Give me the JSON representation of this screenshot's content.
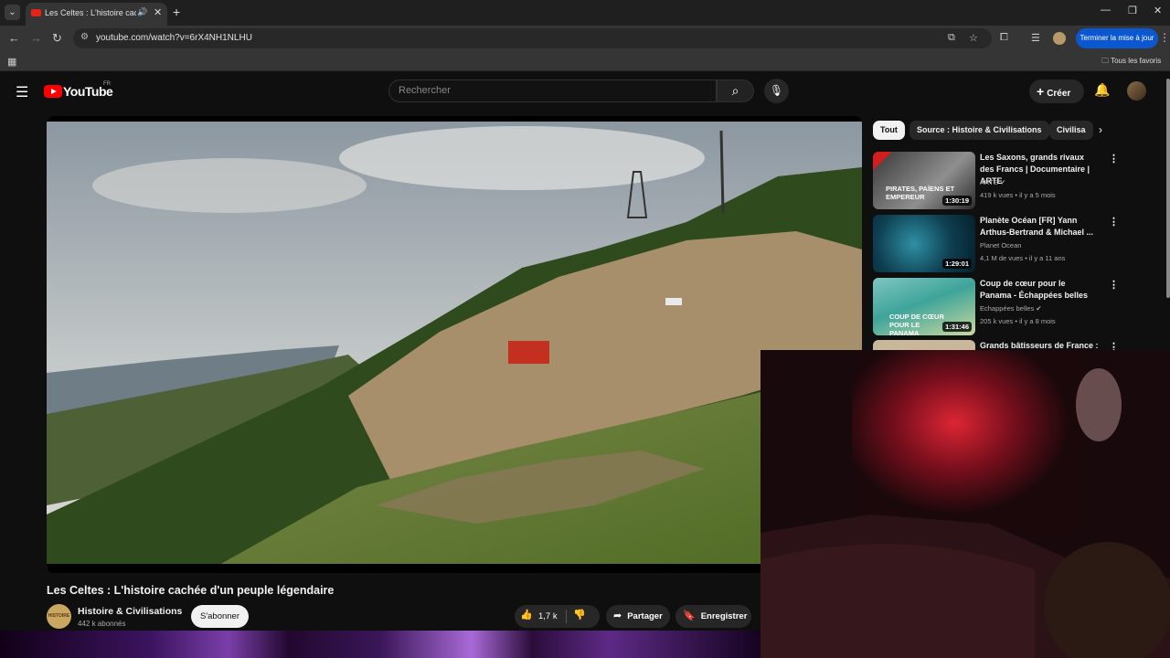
{
  "browser": {
    "tab_title": "Les Celtes : L'histoire cachée d'un peuple légendaire - YouTube",
    "url": "youtube.com/watch?v=6rX4NH1NLHU",
    "update_button": "Terminer la mise à jour",
    "all_bookmarks": "Tous les favoris"
  },
  "header": {
    "logo_text": "YouTube",
    "region": "FR",
    "search_placeholder": "Rechercher",
    "create_label": "Créer"
  },
  "video": {
    "title": "Les Celtes : L'histoire cachée d'un peuple légendaire",
    "channel": "Histoire & Civilisations",
    "avatar_text": "HISTOIRE",
    "subscribers": "442 k abonnés",
    "subscribe_label": "S'abonner",
    "likes": "1,7 k",
    "share_label": "Partager",
    "save_label": "Enregistrer"
  },
  "chips": [
    "Tout",
    "Source : Histoire & Civilisations",
    "Civilisa"
  ],
  "recommendations": [
    {
      "title": "Les Saxons, grands rivaux des Francs | Documentaire | ARTE",
      "channel": "ARTE ✔",
      "meta": "419 k vues • il y a 5 mois",
      "duration": "1:30:19",
      "thumb_text": "PIRATES, PAÏENS ET EMPEREUR",
      "thumb_color": "#6a6a6a"
    },
    {
      "title": "Planète Océan [FR] Yann Arthus-Bertrand & Michael ...",
      "channel": "Planet Ocean",
      "meta": "4,1 M de vues • il y a 11 ans",
      "duration": "1:29:01",
      "thumb_text": "",
      "thumb_color": "#0f4f63"
    },
    {
      "title": "Coup de cœur pour le Panama - Échappées belles",
      "channel": "Echappées belles ✔",
      "meta": "205 k vues • il y a 8 mois",
      "duration": "1:31:46",
      "thumb_text": "COUP DE CŒUR POUR LE PANAMA",
      "thumb_color": "#3aa3a0"
    },
    {
      "title": "Grands bâtisseurs de France :",
      "channel": "",
      "meta": "",
      "duration": "",
      "thumb_text": "",
      "thumb_color": "#c9b79b"
    }
  ]
}
